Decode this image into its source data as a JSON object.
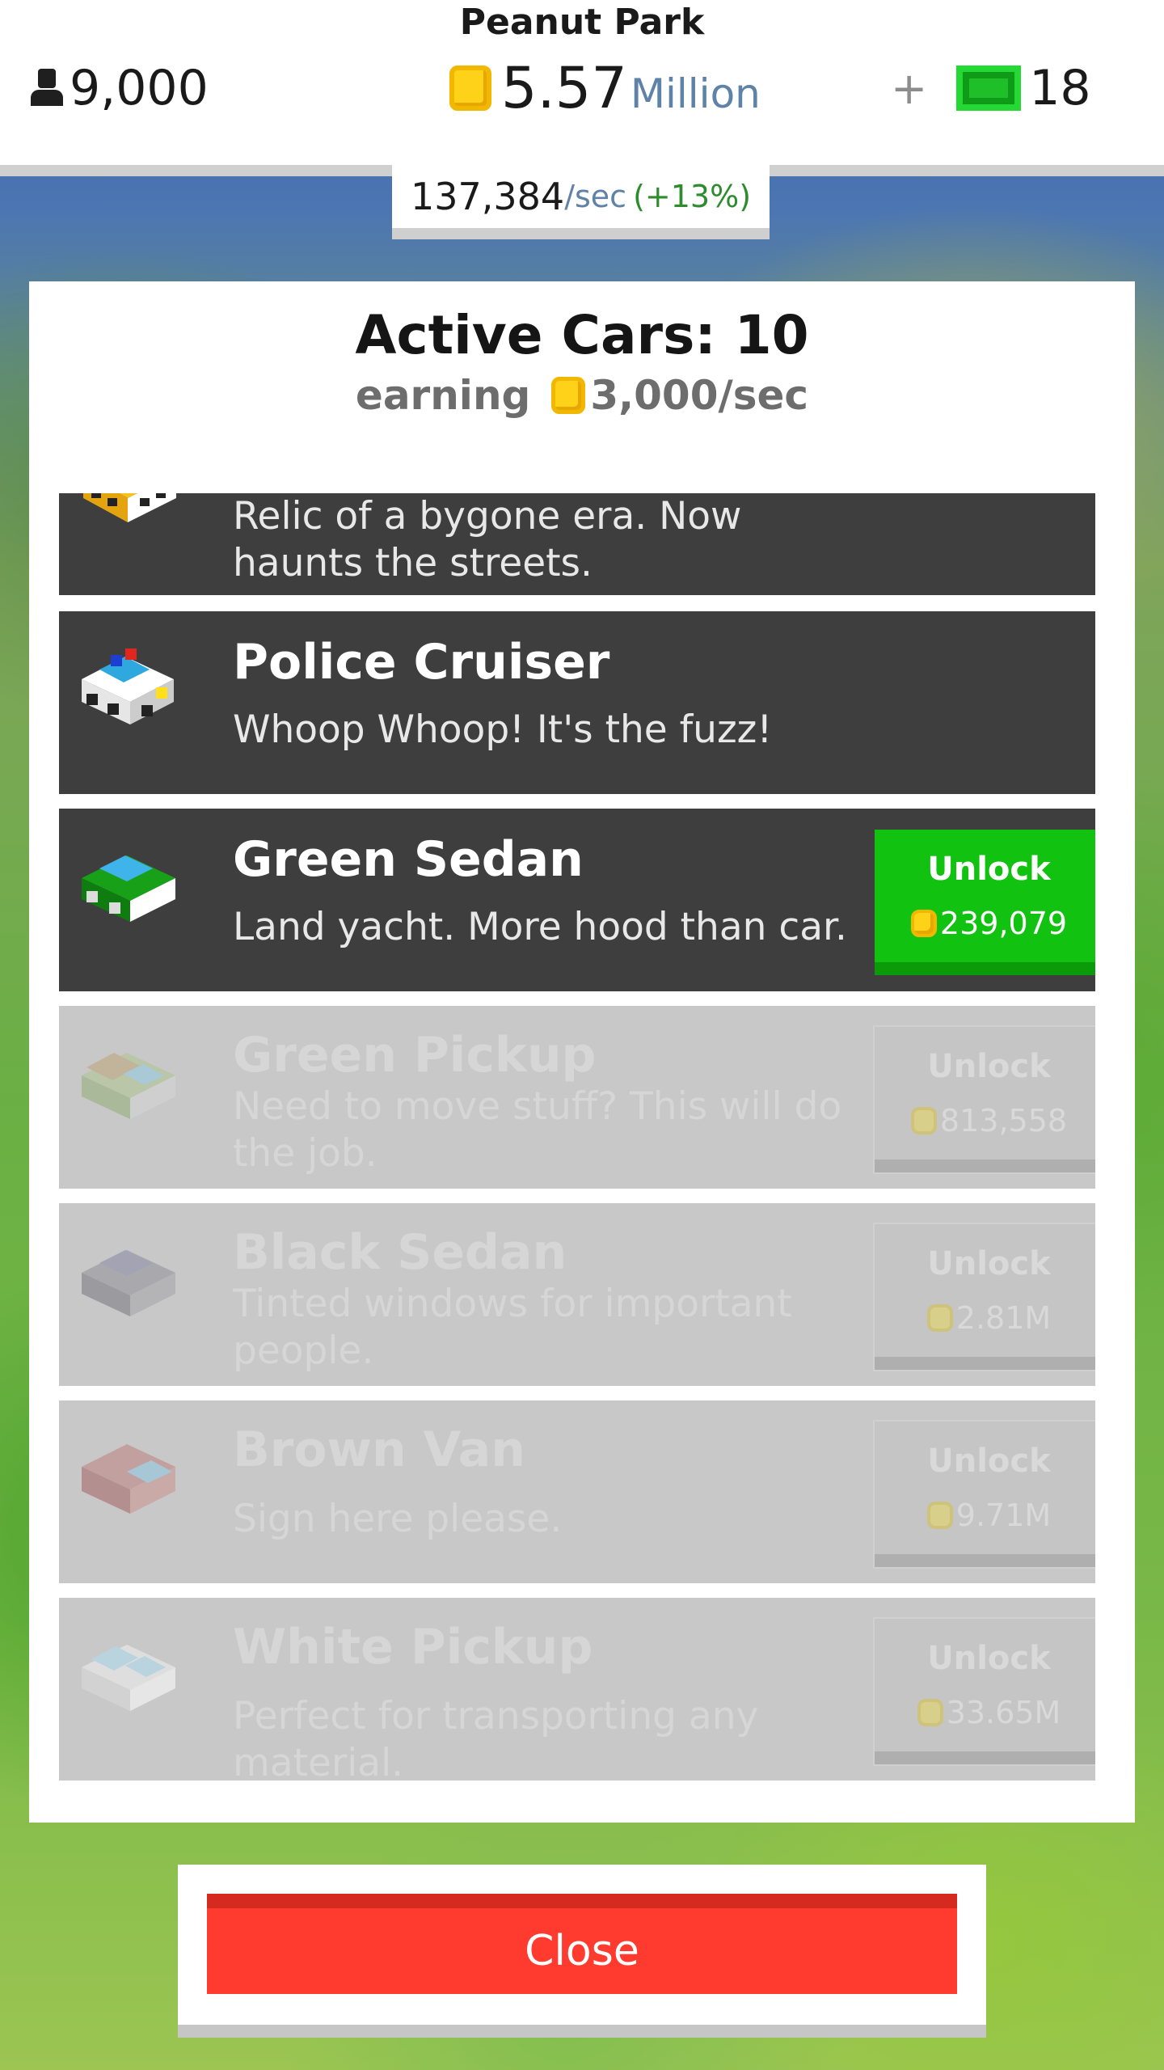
{
  "hud": {
    "park_name": "Peanut Park",
    "population": "9,000",
    "money_value": "5.57",
    "money_unit": "Million",
    "plus_label": "+",
    "cash_value": "18",
    "income_rate": "137,384",
    "income_per": "/sec",
    "income_bonus": "(+13%)"
  },
  "panel": {
    "title": "Active Cars: 10",
    "earning_label": "earning",
    "earning_value": "3,000/sec"
  },
  "cars": [
    {
      "name": "",
      "description": "Relic of a bygone era. Now haunts the streets.",
      "locked": false
    },
    {
      "name": "Police Cruiser",
      "description": "Whoop Whoop! It's the fuzz!",
      "locked": false
    },
    {
      "name": "Green Sedan",
      "description": "Land yacht. More hood than car.",
      "locked": false,
      "unlock_label": "Unlock",
      "cost": "239,079"
    },
    {
      "name": "Green Pickup",
      "description": "Need to move stuff? This will do the job.",
      "locked": true,
      "unlock_label": "Unlock",
      "cost": "813,558"
    },
    {
      "name": "Black Sedan",
      "description": "Tinted windows for important people.",
      "locked": true,
      "unlock_label": "Unlock",
      "cost": "2.81M"
    },
    {
      "name": "Brown Van",
      "description": "Sign here please.",
      "locked": true,
      "unlock_label": "Unlock",
      "cost": "9.71M"
    },
    {
      "name": "White Pickup",
      "description": "Perfect for transporting any material.",
      "locked": true,
      "unlock_label": "Unlock",
      "cost": "33.65M"
    }
  ],
  "close_label": "Close",
  "icons": {
    "population": "person-icon",
    "money": "coin-icon",
    "cash": "cash-icon",
    "cars": [
      "taxi-car-icon",
      "police-car-icon",
      "green-sedan-icon",
      "green-pickup-icon",
      "black-sedan-icon",
      "brown-van-icon",
      "white-pickup-icon"
    ]
  },
  "colors": {
    "unlock_green": "#11c211",
    "close_red": "#ff3a2f",
    "row_dark": "#3e3e3e",
    "row_locked": "#c8c8c8",
    "coin_yellow": "#ffd21a"
  }
}
